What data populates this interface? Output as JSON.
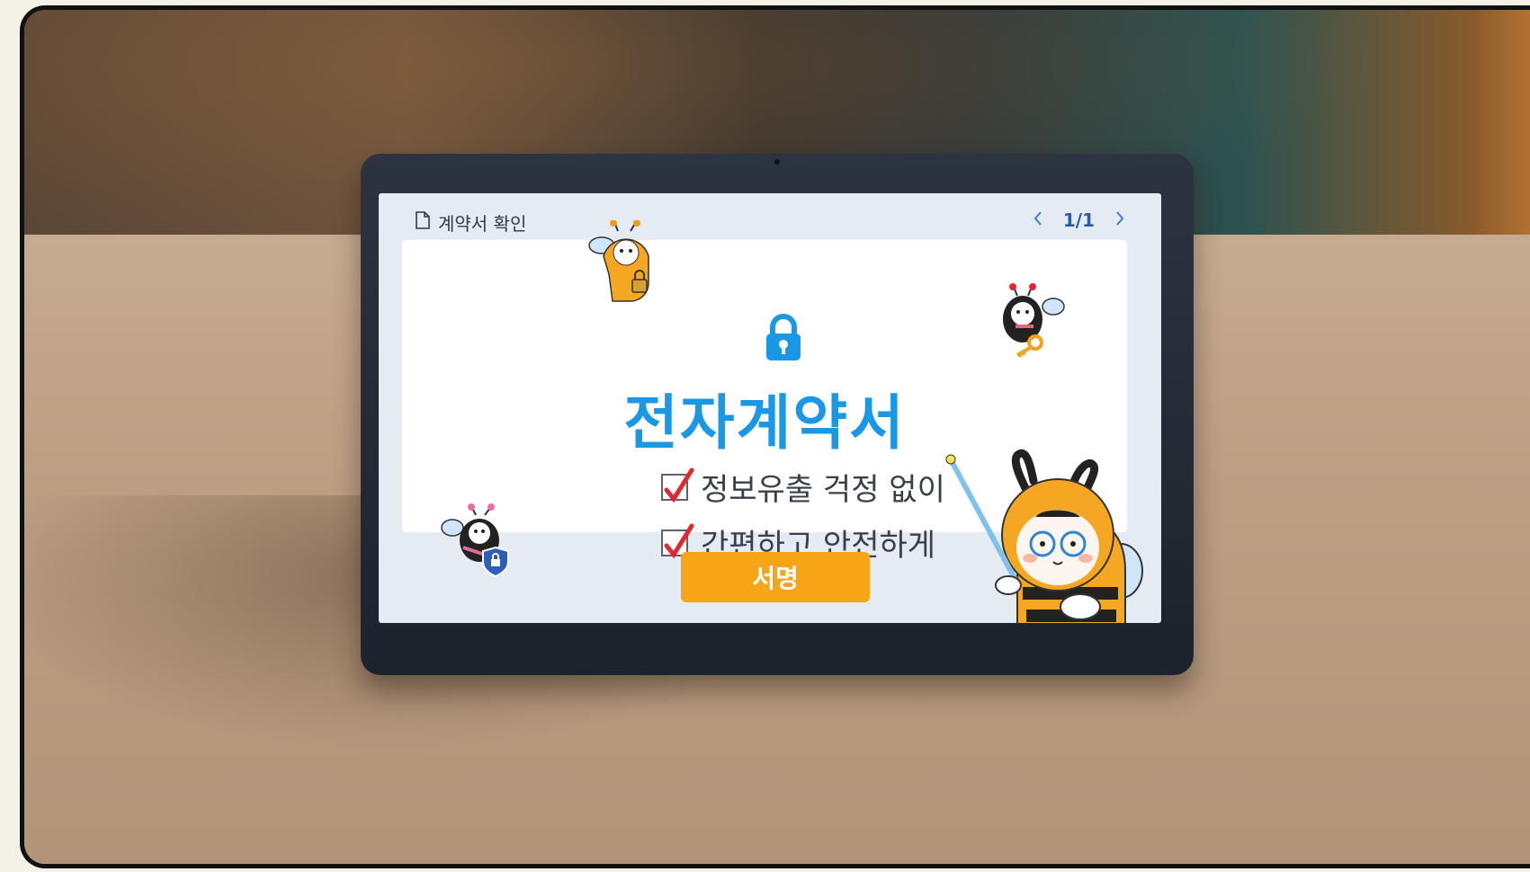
{
  "screen": {
    "doc_title": "계약서 확인",
    "pager": {
      "prev_icon": "chevron-left-icon",
      "page": "1/1",
      "next_icon": "chevron-right-icon"
    },
    "card": {
      "heading": "전자계약서",
      "checks": [
        {
          "label": "정보유출 걱정 없이",
          "checked": true
        },
        {
          "label": "간편하고 안전하게",
          "checked": true
        }
      ]
    },
    "sign_button": "서명"
  },
  "colors": {
    "heading": "#1a98e6",
    "button": "#f7a416",
    "check": "#e0282e",
    "screen_bg": "#e4ebf3"
  },
  "icons": {
    "doc": "document-icon",
    "lock": "lock-icon",
    "check": "checkbox-checked-icon"
  }
}
